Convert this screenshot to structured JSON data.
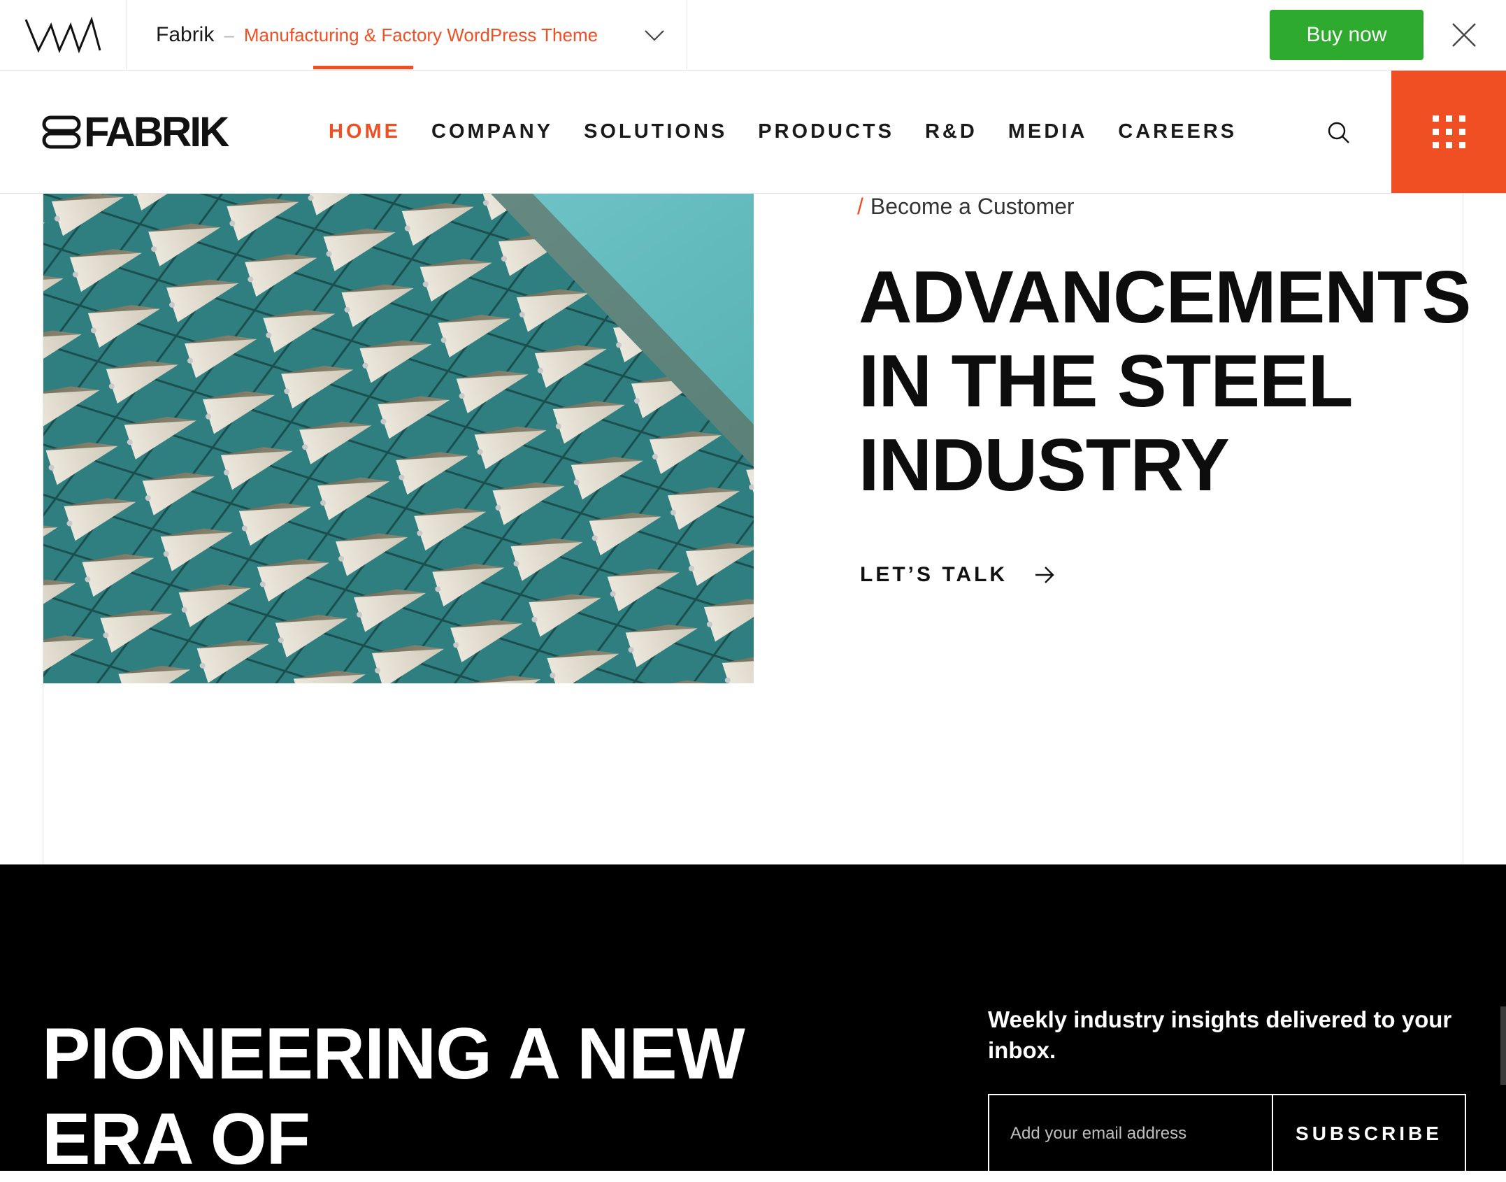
{
  "preview_bar": {
    "theme_name": "Fabrik",
    "separator": "–",
    "theme_description": "Manufacturing & Factory WordPress Theme",
    "buy_label": "Buy now"
  },
  "header": {
    "brand": "FABRIK",
    "nav": [
      {
        "label": "HOME",
        "active": true
      },
      {
        "label": "COMPANY"
      },
      {
        "label": "SOLUTIONS"
      },
      {
        "label": "PRODUCTS"
      },
      {
        "label": "R&D"
      },
      {
        "label": "MEDIA"
      },
      {
        "label": "CAREERS"
      }
    ]
  },
  "hero": {
    "eyebrow_slash": "/",
    "eyebrow": "Become a Customer",
    "title_lines": [
      "ADVANCEMENTS",
      "IN THE STEEL",
      "INDUSTRY"
    ],
    "cta_label": "LET’S TALK"
  },
  "dark_section": {
    "title_lines": [
      "PIONEERING A NEW",
      "ERA OF"
    ],
    "newsletter_text": "Weekly industry insights delivered to your inbox.",
    "email_placeholder": "Add your email address",
    "subscribe_label": "SUBSCRIBE"
  },
  "colors": {
    "accent": "#f04e23",
    "buy_green": "#2eaa2e",
    "dark_bg": "#000000"
  },
  "icons": [
    "vamtam-logo",
    "chevron-down-icon",
    "close-icon",
    "fabrik-logo-icon",
    "search-icon",
    "grid-menu-icon",
    "arrow-right-icon"
  ]
}
